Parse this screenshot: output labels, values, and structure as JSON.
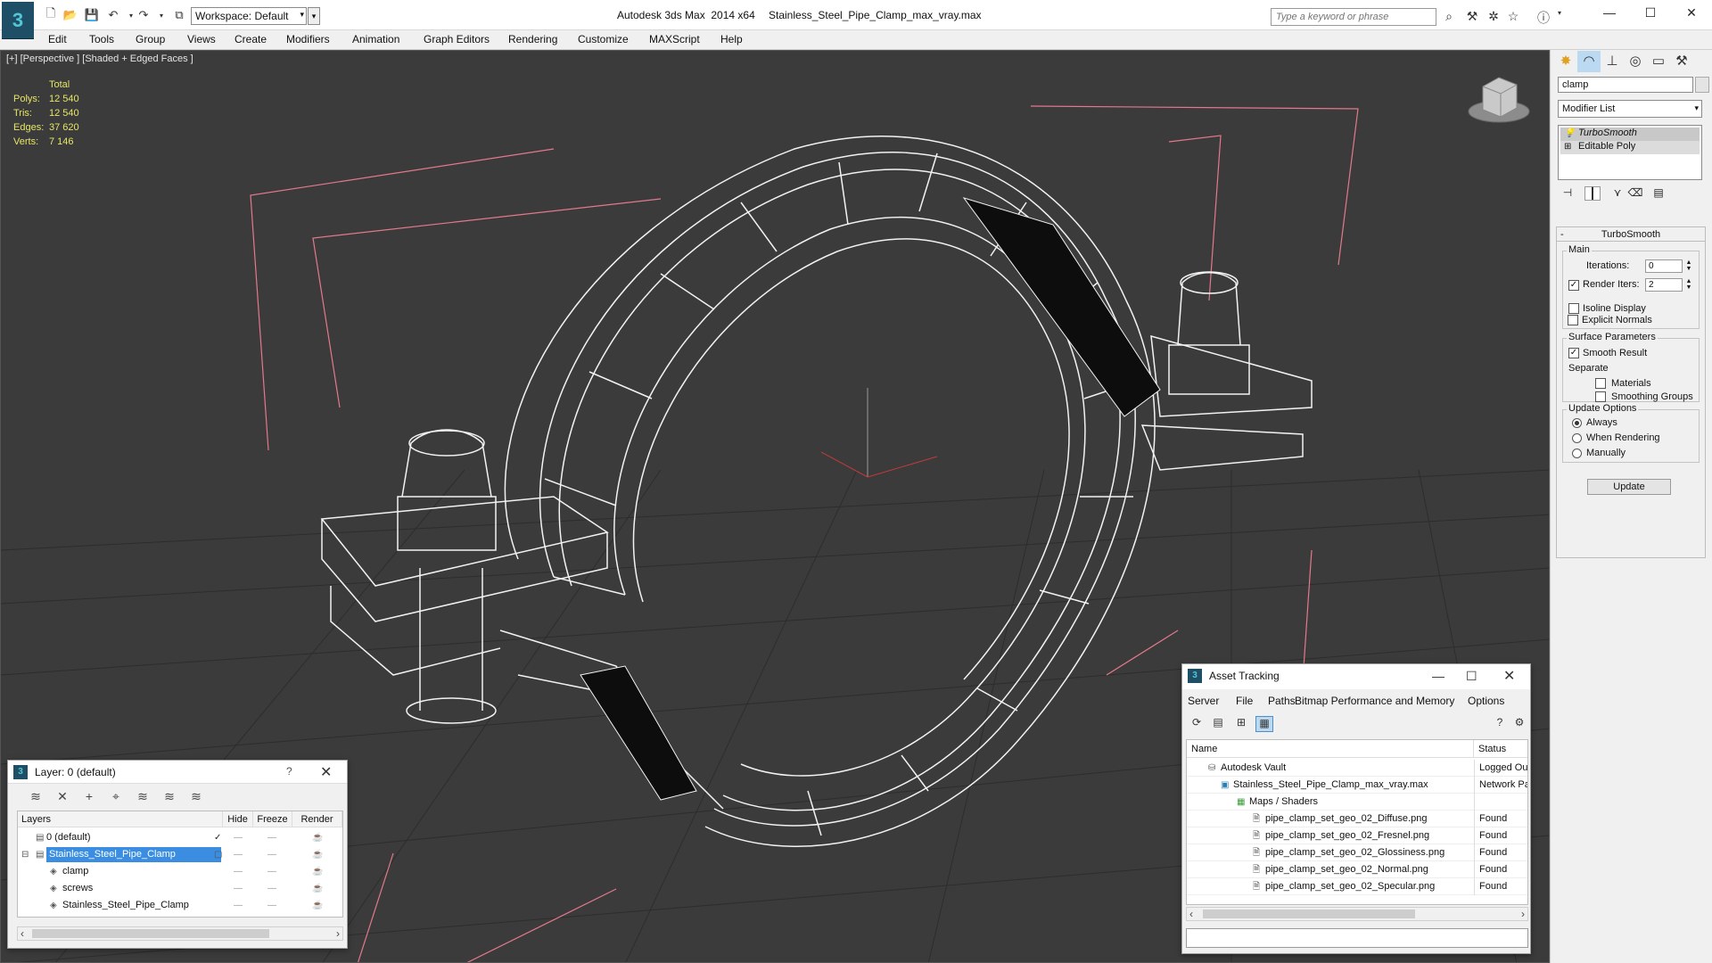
{
  "app": {
    "title": "Autodesk 3ds Max  2014 x64",
    "file": "Stainless_Steel_Pipe_Clamp_max_vray.max",
    "logo": "3",
    "workspace": "Workspace: Default",
    "search_placeholder": "Type a keyword or phrase"
  },
  "menu": [
    "Edit",
    "Tools",
    "Group",
    "Views",
    "Create",
    "Modifiers",
    "Animation",
    "Graph Editors",
    "Rendering",
    "Customize",
    "MAXScript",
    "Help"
  ],
  "viewport": {
    "label": "[+] [Perspective ] [Shaded + Edged Faces ]",
    "stats": {
      "header": "Total",
      "rows": [
        {
          "k": "Polys:",
          "v": "12 540"
        },
        {
          "k": "Tris:",
          "v": "12 540"
        },
        {
          "k": "Edges:",
          "v": "37 620"
        },
        {
          "k": "Verts:",
          "v": "7 146"
        }
      ]
    },
    "colors": {
      "background": "#3b3b3b",
      "grid": "#2c2c2c",
      "wire": "#f2f2f2",
      "bbox": "#e3798c",
      "stats": "#e6e66a"
    }
  },
  "command_panel": {
    "object_name": "clamp",
    "modifier_list": "Modifier List",
    "stack": [
      "TurboSmooth",
      "Editable Poly"
    ],
    "rollout": {
      "title": "TurboSmooth",
      "main_group": "Main",
      "iterations_label": "Iterations:",
      "iterations_value": "0",
      "render_iters_label": "Render Iters:",
      "render_iters_value": "2",
      "isoline": "Isoline Display",
      "explicit": "Explicit Normals",
      "surface_group": "Surface Parameters",
      "smooth_result": "Smooth Result",
      "separate": "Separate",
      "materials": "Materials",
      "smoothing_groups": "Smoothing Groups",
      "update_group": "Update Options",
      "always": "Always",
      "when_rendering": "When Rendering",
      "manually": "Manually",
      "update_button": "Update"
    }
  },
  "layer_dialog": {
    "title": "Layer: 0 (default)",
    "help": "?",
    "columns": [
      "Layers",
      "Hide",
      "Freeze",
      "Render"
    ],
    "rows": [
      {
        "name": "0 (default)",
        "indent": 0,
        "selected": false
      },
      {
        "name": "Stainless_Steel_Pipe_Clamp",
        "indent": 0,
        "selected": true
      },
      {
        "name": "clamp",
        "indent": 1,
        "selected": false
      },
      {
        "name": "screws",
        "indent": 1,
        "selected": false
      },
      {
        "name": "Stainless_Steel_Pipe_Clamp",
        "indent": 1,
        "selected": false
      }
    ]
  },
  "asset_dialog": {
    "title": "Asset Tracking",
    "menu": [
      "Server",
      "File",
      "Paths",
      "Bitmap Performance and Memory",
      "Options"
    ],
    "columns": [
      "Name",
      "Status"
    ],
    "rows": [
      {
        "name": "Autodesk Vault",
        "status": "Logged Out",
        "indent": 0,
        "icon": "vault-icon"
      },
      {
        "name": "Stainless_Steel_Pipe_Clamp_max_vray.max",
        "status": "Network Path",
        "indent": 1,
        "icon": "max-file-icon"
      },
      {
        "name": "Maps / Shaders",
        "status": "",
        "indent": 2,
        "icon": "maps-icon"
      },
      {
        "name": "pipe_clamp_set_geo_02_Diffuse.png",
        "status": "Found",
        "indent": 3,
        "icon": "image-file-icon"
      },
      {
        "name": "pipe_clamp_set_geo_02_Fresnel.png",
        "status": "Found",
        "indent": 3,
        "icon": "image-file-icon"
      },
      {
        "name": "pipe_clamp_set_geo_02_Glossiness.png",
        "status": "Found",
        "indent": 3,
        "icon": "image-file-icon"
      },
      {
        "name": "pipe_clamp_set_geo_02_Normal.png",
        "status": "Found",
        "indent": 3,
        "icon": "image-file-icon"
      },
      {
        "name": "pipe_clamp_set_geo_02_Specular.png",
        "status": "Found",
        "indent": 3,
        "icon": "image-file-icon"
      }
    ]
  }
}
